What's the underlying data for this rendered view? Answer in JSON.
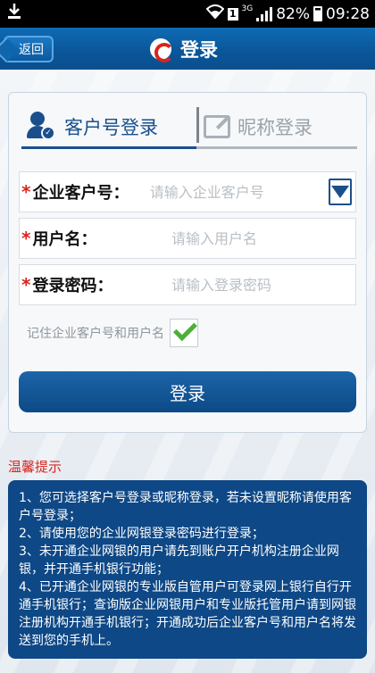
{
  "status_bar": {
    "network_type": "3G",
    "sim_label": "1",
    "battery": "82%",
    "time": "09:28"
  },
  "header": {
    "back_label": "返回",
    "title": "登录"
  },
  "tabs": [
    {
      "label": "客户号登录",
      "active": true
    },
    {
      "label": "昵称登录",
      "active": false
    }
  ],
  "form": {
    "company_id": {
      "label": "企业客户号：",
      "placeholder": "请输入企业客户号"
    },
    "username": {
      "label": "用户名：",
      "placeholder": "请输入用户名"
    },
    "password": {
      "label": "登录密码：",
      "placeholder": "请输入登录密码"
    },
    "remember_label": "记住企业客户号和用户名",
    "remember_checked": true,
    "submit_label": "登录"
  },
  "tips": {
    "title": "温馨提示",
    "lines": [
      "1、您可选择客户号登录或昵称登录，若未设置昵称请使用客户号登录；",
      "2、请使用您的企业网银登录密码进行登录；",
      "3、未开通企业网银的用户请先到账户开户机构注册企业网银，并开通手机银行功能；",
      "4、已开通企业网银的专业版自管用户可登录网上银行自行开通手机银行；查询版企业网银用户和专业版托管用户请到网银注册机构开通手机银行；开通成功后企业客户号和用户名将发送到您的手机上。"
    ]
  },
  "colors": {
    "header_blue": "#0a5598",
    "primary": "#1a4f8c",
    "required_red": "#d8251d",
    "check_green": "#4caf3a"
  }
}
